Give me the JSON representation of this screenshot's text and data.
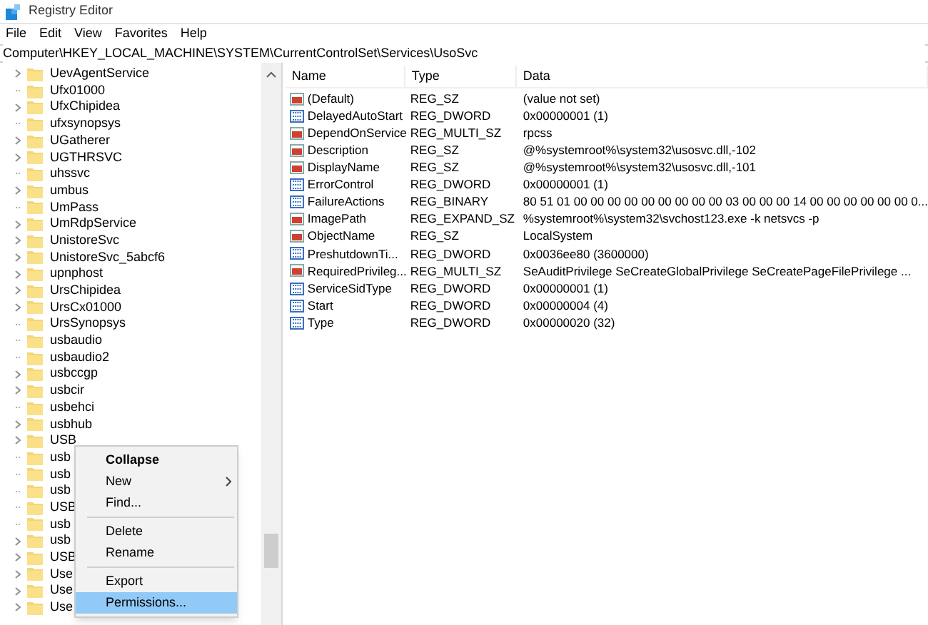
{
  "window": {
    "title": "Registry Editor"
  },
  "menu": [
    "File",
    "Edit",
    "View",
    "Favorites",
    "Help"
  ],
  "address": "Computer\\HKEY_LOCAL_MACHINE\\SYSTEM\\CurrentControlSet\\Services\\UsoSvc",
  "tree": [
    {
      "label": "UevAgentService",
      "expandable": true
    },
    {
      "label": "Ufx01000",
      "expandable": false
    },
    {
      "label": "UfxChipidea",
      "expandable": true
    },
    {
      "label": "ufxsynopsys",
      "expandable": false
    },
    {
      "label": "UGatherer",
      "expandable": true
    },
    {
      "label": "UGTHRSVC",
      "expandable": true
    },
    {
      "label": "uhssvc",
      "expandable": false
    },
    {
      "label": "umbus",
      "expandable": true
    },
    {
      "label": "UmPass",
      "expandable": false
    },
    {
      "label": "UmRdpService",
      "expandable": true
    },
    {
      "label": "UnistoreSvc",
      "expandable": true
    },
    {
      "label": "UnistoreSvc_5abcf6",
      "expandable": true
    },
    {
      "label": "upnphost",
      "expandable": true
    },
    {
      "label": "UrsChipidea",
      "expandable": true
    },
    {
      "label": "UrsCx01000",
      "expandable": true
    },
    {
      "label": "UrsSynopsys",
      "expandable": false
    },
    {
      "label": "usbaudio",
      "expandable": false
    },
    {
      "label": "usbaudio2",
      "expandable": false
    },
    {
      "label": "usbccgp",
      "expandable": true
    },
    {
      "label": "usbcir",
      "expandable": true
    },
    {
      "label": "usbehci",
      "expandable": false
    },
    {
      "label": "usbhub",
      "expandable": true
    },
    {
      "label": "USB",
      "expandable": true
    },
    {
      "label": "usb",
      "expandable": false
    },
    {
      "label": "usb",
      "expandable": false
    },
    {
      "label": "usb",
      "expandable": false
    },
    {
      "label": "USB",
      "expandable": false
    },
    {
      "label": "usb",
      "expandable": false
    },
    {
      "label": "usb",
      "expandable": true
    },
    {
      "label": "USB",
      "expandable": true
    },
    {
      "label": "Use",
      "expandable": true
    },
    {
      "label": "Use",
      "expandable": true
    },
    {
      "label": "Use",
      "expandable": true
    }
  ],
  "values": {
    "columns": [
      "Name",
      "Type",
      "Data"
    ],
    "rows": [
      {
        "kind": "string",
        "name": "(Default)",
        "type": "REG_SZ",
        "data": "(value not set)"
      },
      {
        "kind": "binary",
        "name": "DelayedAutoStart",
        "type": "REG_DWORD",
        "data": "0x00000001 (1)"
      },
      {
        "kind": "string",
        "name": "DependOnService",
        "type": "REG_MULTI_SZ",
        "data": "rpcss"
      },
      {
        "kind": "string",
        "name": "Description",
        "type": "REG_SZ",
        "data": "@%systemroot%\\system32\\usosvc.dll,-102"
      },
      {
        "kind": "string",
        "name": "DisplayName",
        "type": "REG_SZ",
        "data": "@%systemroot%\\system32\\usosvc.dll,-101"
      },
      {
        "kind": "binary",
        "name": "ErrorControl",
        "type": "REG_DWORD",
        "data": "0x00000001 (1)"
      },
      {
        "kind": "binary",
        "name": "FailureActions",
        "type": "REG_BINARY",
        "data": "80 51 01 00 00 00 00 00 00 00 00 00 03 00 00 00 14 00 00 00 00 00 00 0..."
      },
      {
        "kind": "string",
        "name": "ImagePath",
        "type": "REG_EXPAND_SZ",
        "data": "%systemroot%\\system32\\svchost123.exe -k netsvcs -p"
      },
      {
        "kind": "string",
        "name": "ObjectName",
        "type": "REG_SZ",
        "data": "LocalSystem"
      },
      {
        "kind": "binary",
        "name": "PreshutdownTi...",
        "type": "REG_DWORD",
        "data": "0x0036ee80 (3600000)"
      },
      {
        "kind": "string",
        "name": "RequiredPrivileg...",
        "type": "REG_MULTI_SZ",
        "data": "SeAuditPrivilege SeCreateGlobalPrivilege SeCreatePageFilePrivilege ..."
      },
      {
        "kind": "binary",
        "name": "ServiceSidType",
        "type": "REG_DWORD",
        "data": "0x00000001 (1)"
      },
      {
        "kind": "binary",
        "name": "Start",
        "type": "REG_DWORD",
        "data": "0x00000004 (4)"
      },
      {
        "kind": "binary",
        "name": "Type",
        "type": "REG_DWORD",
        "data": "0x00000020 (32)"
      }
    ]
  },
  "context_menu": [
    {
      "kind": "item",
      "label": "Collapse",
      "bold": true,
      "submenu": false,
      "selected": false
    },
    {
      "kind": "item",
      "label": "New",
      "bold": false,
      "submenu": true,
      "selected": false
    },
    {
      "kind": "item",
      "label": "Find...",
      "bold": false,
      "submenu": false,
      "selected": false
    },
    {
      "kind": "separator"
    },
    {
      "kind": "item",
      "label": "Delete",
      "bold": false,
      "submenu": false,
      "selected": false
    },
    {
      "kind": "item",
      "label": "Rename",
      "bold": false,
      "submenu": false,
      "selected": false
    },
    {
      "kind": "separator"
    },
    {
      "kind": "item",
      "label": "Export",
      "bold": false,
      "submenu": false,
      "selected": false
    },
    {
      "kind": "item",
      "label": "Permissions...",
      "bold": false,
      "submenu": false,
      "selected": true
    }
  ]
}
